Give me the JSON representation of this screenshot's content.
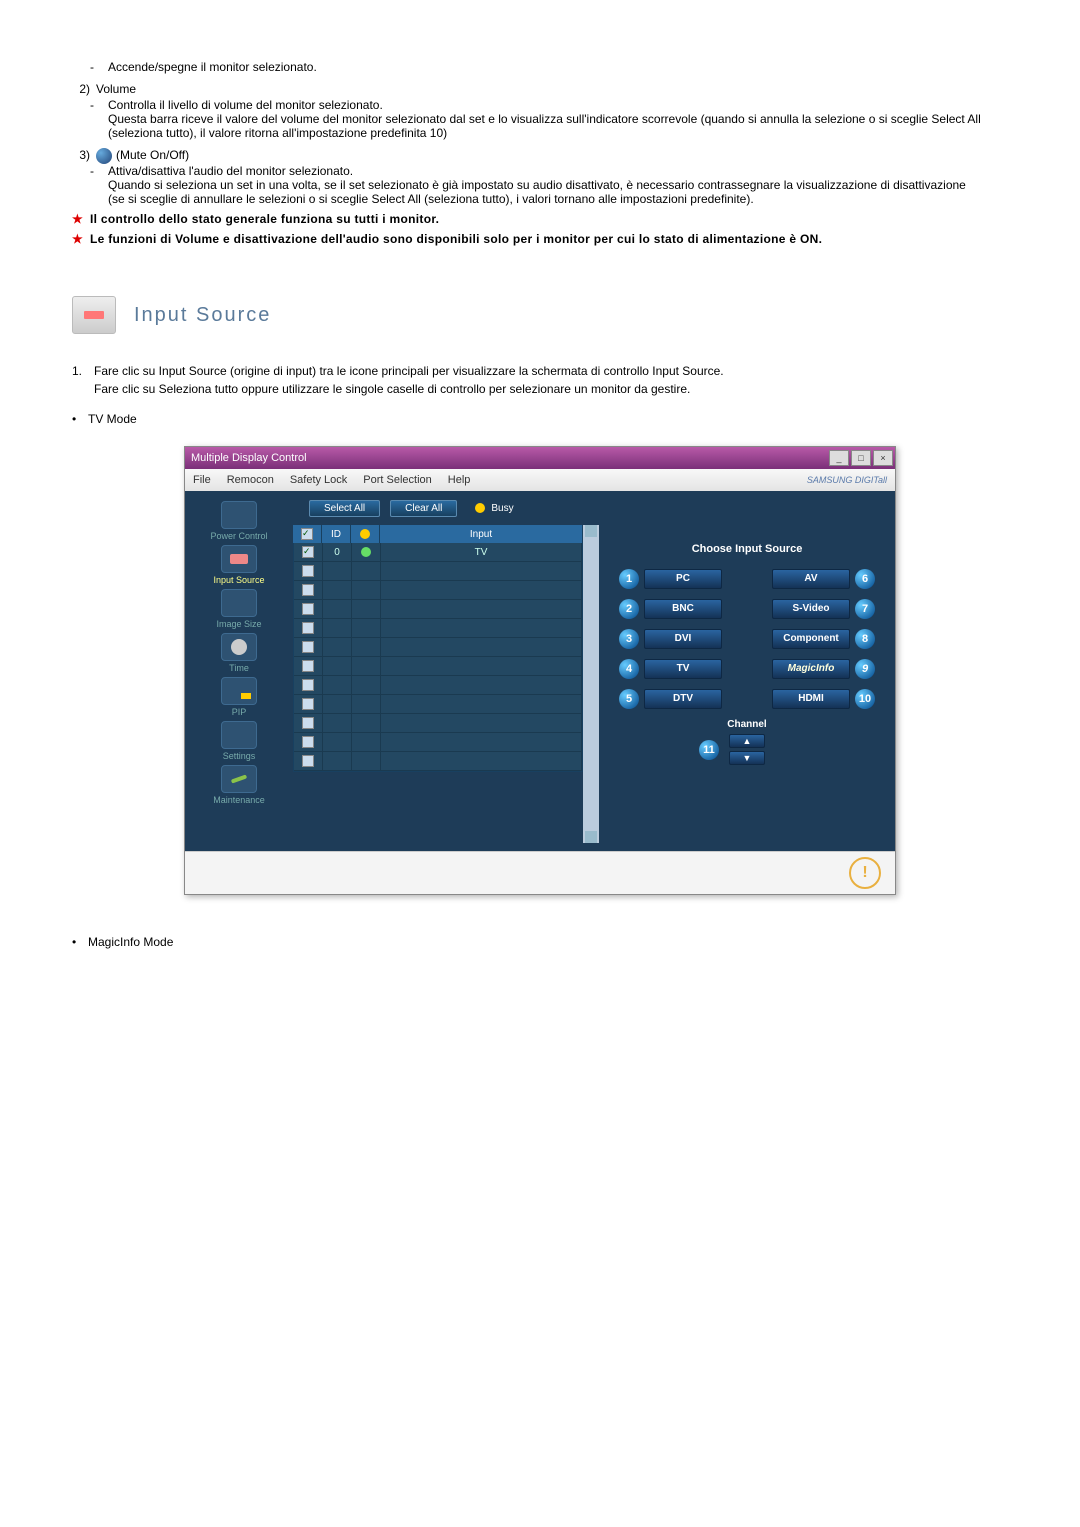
{
  "intro": {
    "power_desc": "Accende/spegne il monitor selezionato.",
    "item2_num": "2)",
    "item2_label": "Volume",
    "item2_line1": "Controlla il livello di volume del monitor selezionato.",
    "item2_line2": "Questa barra riceve il valore del volume del monitor selezionato dal set e lo visualizza sull'indicatore scorrevole (quando si annulla la selezione o si sceglie Select All (seleziona tutto), il valore ritorna all'impostazione predefinita 10)",
    "item3_num": "3)",
    "item3_label": "(Mute On/Off)",
    "item3_line1": "Attiva/disattiva l'audio del monitor selezionato.",
    "item3_line2": "Quando si seleziona un set in una volta, se il set selezionato è già impostato su audio disattivato, è necessario contrassegnare la visualizzazione di disattivazione",
    "item3_line3": "(se si sceglie di annullare le selezioni o si sceglie Select All (seleziona tutto), i valori tornano alle impostazioni predefinite).",
    "star1": "Il controllo dello stato generale funziona su tutti i monitor.",
    "star2": "Le funzioni di Volume e disattivazione dell'audio sono disponibili solo per i monitor per cui lo stato di alimentazione è ON."
  },
  "section": {
    "title": "Input Source"
  },
  "para": {
    "n": "1.",
    "p1": "Fare clic su Input Source (origine di input) tra le icone principali per visualizzare la schermata di controllo Input Source.",
    "p2": "Fare clic su Seleziona tutto oppure utilizzare le singole caselle di controllo per selezionare un monitor da gestire."
  },
  "modes": {
    "tv": "TV Mode",
    "magic": "MagicInfo Mode"
  },
  "shot": {
    "title": "Multiple Display Control",
    "menu": {
      "file": "File",
      "remocon": "Remocon",
      "safety": "Safety Lock",
      "port": "Port Selection",
      "help": "Help"
    },
    "brand": "SAMSUNG DIGITall",
    "toolbar": {
      "select_all": "Select All",
      "clear_all": "Clear All",
      "busy": "Busy"
    },
    "sidebar": {
      "power": "Power Control",
      "input": "Input Source",
      "image": "Image Size",
      "time": "Time",
      "pip": "PIP",
      "settings": "Settings",
      "maint": "Maintenance"
    },
    "grid": {
      "h_id": "ID",
      "h_input": "Input",
      "row0_id": "0",
      "row0_input": "TV"
    },
    "panel": {
      "title": "Choose Input Source",
      "pc": "PC",
      "av": "AV",
      "bnc": "BNC",
      "svideo": "S-Video",
      "dvi": "DVI",
      "component": "Component",
      "tv": "TV",
      "magicinfo": "MagicInfo",
      "dtv": "DTV",
      "hdmi": "HDMI",
      "channel": "Channel",
      "n1": "1",
      "n2": "2",
      "n3": "3",
      "n4": "4",
      "n5": "5",
      "n6": "6",
      "n7": "7",
      "n8": "8",
      "n9": "9",
      "n10": "10",
      "n11": "11"
    }
  }
}
